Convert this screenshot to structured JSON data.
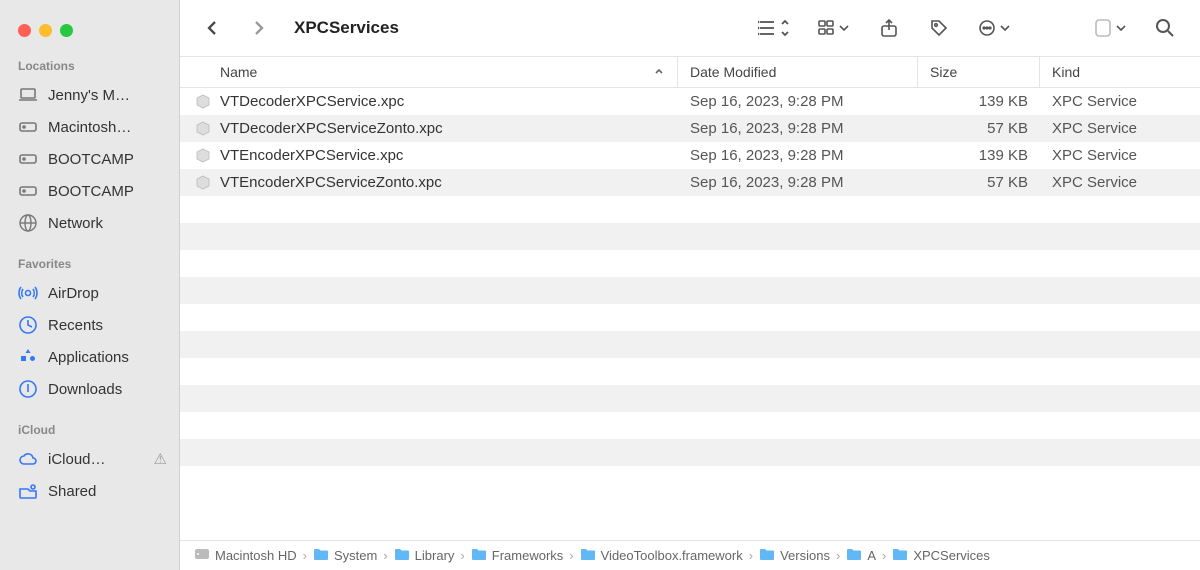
{
  "sidebar": {
    "sections": [
      {
        "title": "Locations",
        "items": [
          {
            "label": "Jenny's M…",
            "icon": "laptop",
            "gray": true
          },
          {
            "label": "Macintosh…",
            "icon": "hdd",
            "gray": true
          },
          {
            "label": "BOOTCAMP",
            "icon": "hdd",
            "gray": true
          },
          {
            "label": "BOOTCAMP",
            "icon": "hdd",
            "gray": true
          },
          {
            "label": "Network",
            "icon": "globe",
            "gray": true
          }
        ]
      },
      {
        "title": "Favorites",
        "items": [
          {
            "label": "AirDrop",
            "icon": "airdrop"
          },
          {
            "label": "Recents",
            "icon": "clock"
          },
          {
            "label": "Applications",
            "icon": "apps"
          },
          {
            "label": "Downloads",
            "icon": "download"
          }
        ]
      },
      {
        "title": "iCloud",
        "items": [
          {
            "label": "iCloud…",
            "icon": "cloud",
            "warn": true
          },
          {
            "label": "Shared",
            "icon": "shared"
          }
        ]
      }
    ]
  },
  "window": {
    "title": "XPCServices"
  },
  "columns": {
    "name": "Name",
    "date": "Date Modified",
    "size": "Size",
    "kind": "Kind"
  },
  "files": [
    {
      "name": "VTDecoderXPCService.xpc",
      "date": "Sep 16, 2023, 9:28 PM",
      "size": "139 KB",
      "kind": "XPC Service"
    },
    {
      "name": "VTDecoderXPCServiceZonto.xpc",
      "date": "Sep 16, 2023, 9:28 PM",
      "size": "57 KB",
      "kind": "XPC Service"
    },
    {
      "name": "VTEncoderXPCService.xpc",
      "date": "Sep 16, 2023, 9:28 PM",
      "size": "139 KB",
      "kind": "XPC Service"
    },
    {
      "name": "VTEncoderXPCServiceZonto.xpc",
      "date": "Sep 16, 2023, 9:28 PM",
      "size": "57 KB",
      "kind": "XPC Service"
    }
  ],
  "path": [
    {
      "label": "Macintosh HD",
      "icon": "disk"
    },
    {
      "label": "System",
      "icon": "folder"
    },
    {
      "label": "Library",
      "icon": "folder"
    },
    {
      "label": "Frameworks",
      "icon": "folder"
    },
    {
      "label": "VideoToolbox.framework",
      "icon": "folder"
    },
    {
      "label": "Versions",
      "icon": "folder"
    },
    {
      "label": "A",
      "icon": "folder"
    },
    {
      "label": "XPCServices",
      "icon": "folder"
    }
  ]
}
